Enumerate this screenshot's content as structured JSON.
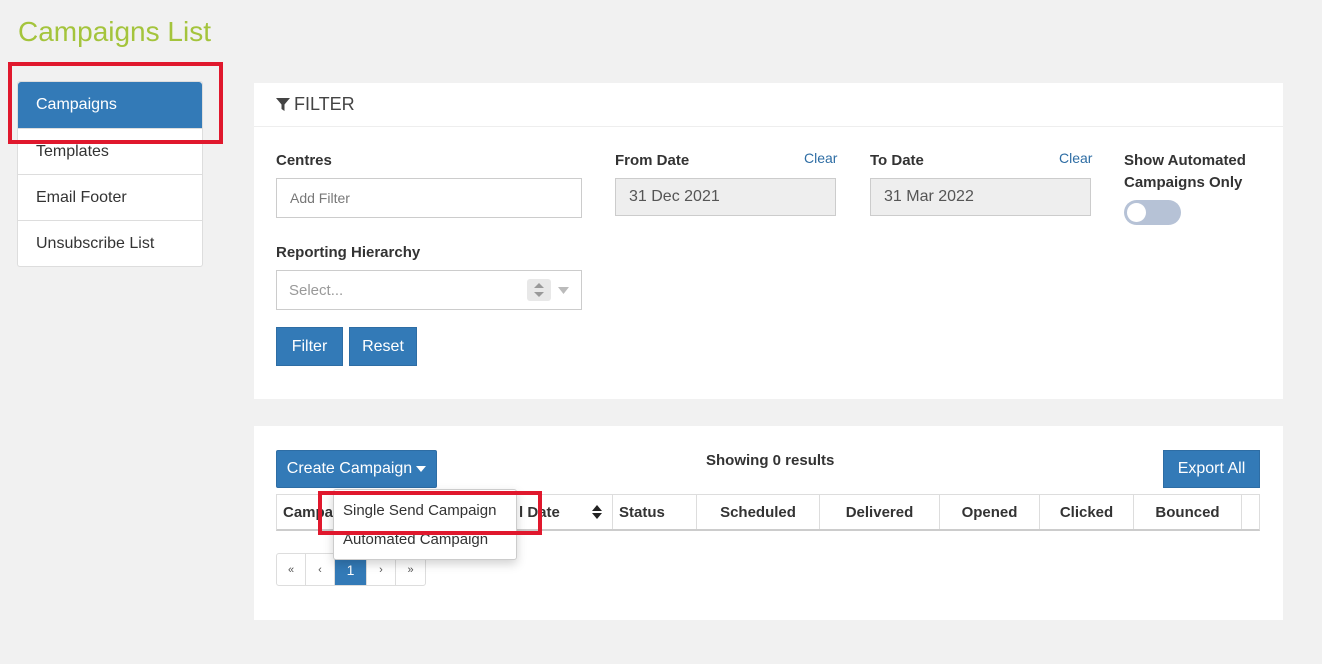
{
  "page": {
    "title": "Campaigns List"
  },
  "sidebar": {
    "items": [
      {
        "label": "Campaigns",
        "active": true
      },
      {
        "label": "Templates"
      },
      {
        "label": "Email Footer"
      },
      {
        "label": "Unsubscribe List"
      }
    ]
  },
  "filter": {
    "title": "FILTER",
    "centres": {
      "label": "Centres",
      "placeholder": "Add Filter"
    },
    "from_date": {
      "label": "From Date",
      "clear": "Clear",
      "value": "31 Dec 2021"
    },
    "to_date": {
      "label": "To Date",
      "clear": "Clear",
      "value": "31 Mar 2022"
    },
    "automated_only": {
      "label_line1": "Show Automated",
      "label_line2": "Campaigns Only",
      "on": false
    },
    "hierarchy": {
      "label": "Reporting Hierarchy",
      "placeholder": "Select..."
    },
    "filter_button": "Filter",
    "reset_button": "Reset"
  },
  "list": {
    "create_button": "Create Campaign",
    "results_text": "Showing 0 results",
    "export_button": "Export All",
    "columns": {
      "campaign": "Campa",
      "send_date": "l Date",
      "status": "Status",
      "scheduled": "Scheduled",
      "delivered": "Delivered",
      "opened": "Opened",
      "clicked": "Clicked",
      "bounced": "Bounced"
    },
    "pagination": {
      "first": "«",
      "prev": "‹",
      "current": "1",
      "next": "›",
      "last": "»"
    }
  },
  "create_menu": {
    "items": [
      "Single Send Campaign",
      "Automated Campaign"
    ]
  },
  "colors": {
    "primary": "#337ab7",
    "title_green": "#a4c43c",
    "highlight": "#e0182d"
  }
}
